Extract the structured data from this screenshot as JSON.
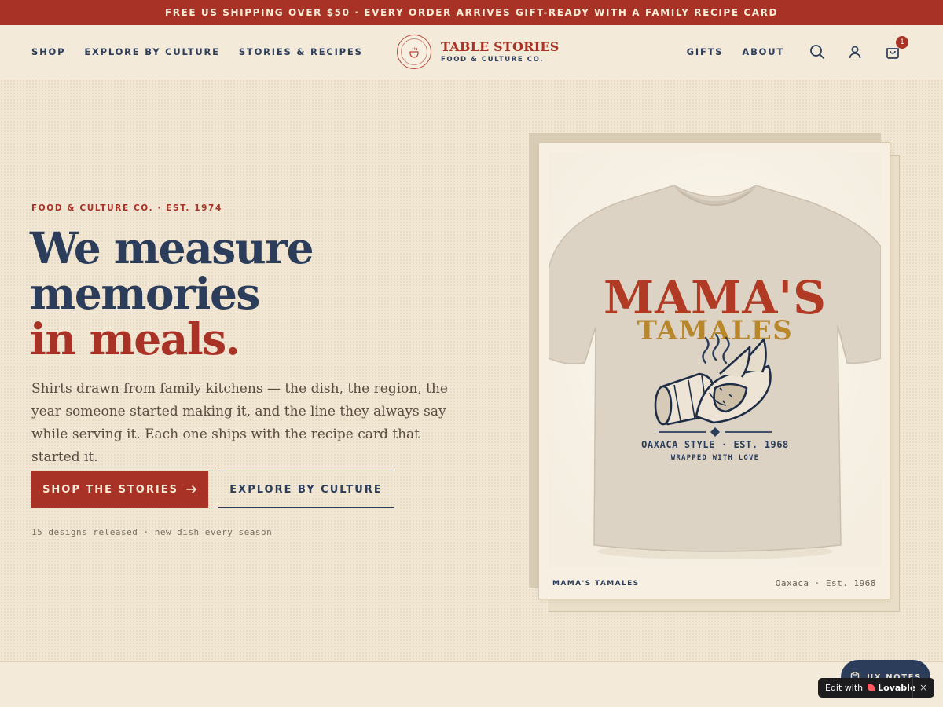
{
  "promo": {
    "text": "FREE US SHIPPING OVER $50 · EVERY ORDER ARRIVES GIFT-READY WITH A FAMILY RECIPE CARD"
  },
  "nav": {
    "left_links": [
      "SHOP",
      "EXPLORE BY CULTURE",
      "STORIES & RECIPES"
    ],
    "brand_name": "TABLE STORIES",
    "brand_sub": "FOOD & CULTURE CO.",
    "right_links": [
      "GIFTS",
      "ABOUT"
    ],
    "cart_count": "1",
    "icons": [
      "search-icon",
      "account-icon",
      "cart-icon"
    ]
  },
  "hero": {
    "eyebrow": "FOOD & CULTURE CO. · EST. 1974",
    "headline_line1": "We measure",
    "headline_line2": "memories",
    "headline_accent": "in meals.",
    "description": "Shirts drawn from family kitchens — the dish, the region, the year someone started making it, and the line they always say while serving it. Each one ships with the recipe card that started it.",
    "primary_cta": "SHOP THE STORIES",
    "secondary_cta": "EXPLORE BY CULTURE",
    "meta": "15 designs released · new dish every season"
  },
  "product_card": {
    "shirt_title": "MAMA'S",
    "shirt_subtitle": "TAMALES",
    "shirt_line1": "OAXACA STYLE · EST. 1968",
    "shirt_line2": "WRAPPED WITH LOVE",
    "caption_name": "MAMA'S TAMALES",
    "caption_origin": "Oaxaca · Est. 1968"
  },
  "widgets": {
    "ux_notes": "UX NOTES",
    "lovable_prefix": "Edit with",
    "lovable_brand": "Lovable",
    "lovable_close": "×"
  },
  "colors": {
    "brand_red": "#a83226",
    "navy": "#2b3d5a",
    "cream": "#f3ead9",
    "mustard": "#b8862b"
  }
}
